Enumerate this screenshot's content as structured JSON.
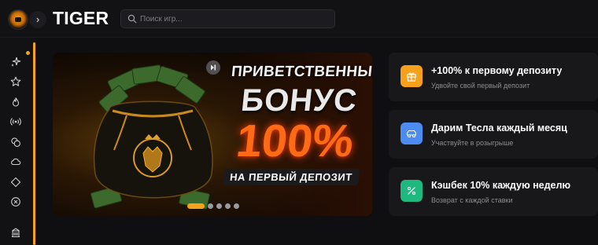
{
  "header": {
    "brand": "TIGER",
    "search": {
      "placeholder": "Поиск игр...",
      "value": ""
    },
    "toggle_glyph": "›"
  },
  "sidebar": {
    "accent": "#f7a21b",
    "icons": [
      "sparkle-icon",
      "star-icon",
      "flame-icon",
      "broadcast-icon",
      "chips-icon",
      "cloud-icon",
      "diamond-icon",
      "no-sign-icon",
      "building-icon"
    ]
  },
  "banner": {
    "line1": "ПРИВЕТСТВЕННЫЙ",
    "line2": "БОНУС",
    "line3": "100%",
    "line4": "НА ПЕРВЫЙ ДЕПОЗИТ",
    "slides_total": 5,
    "active_slide": 1
  },
  "promos": [
    {
      "title": "+100% к первому депозиту",
      "subtitle": "Удвойте свой первый депозит",
      "icon": "gift-icon",
      "color": "#f5a11c"
    },
    {
      "title": "Дарим Тесла каждый месяц",
      "subtitle": "Участвуйте в розыгрыше",
      "icon": "car-icon",
      "color": "#4c8cf0"
    },
    {
      "title": "Кэшбек 10% каждую неделю",
      "subtitle": "Возврат с каждой ставки",
      "icon": "percent-icon",
      "color": "#1fb980"
    }
  ]
}
